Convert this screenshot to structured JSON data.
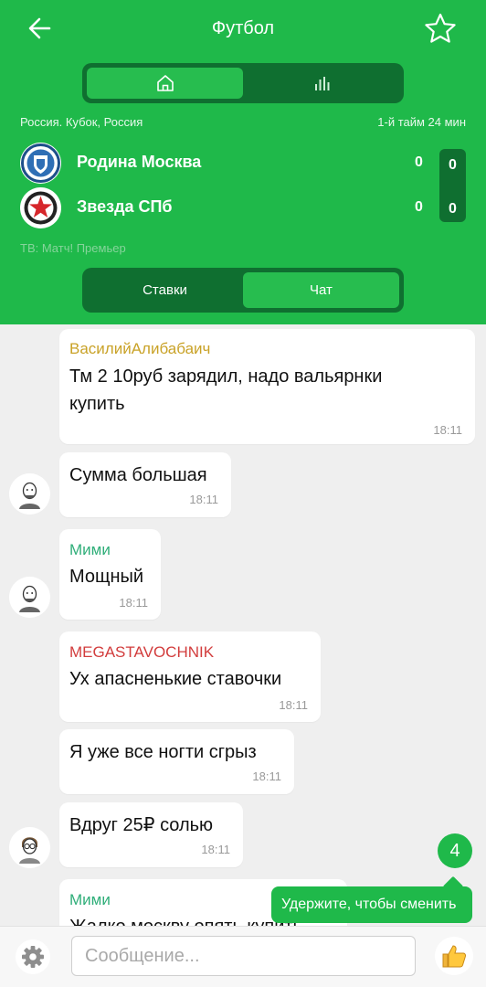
{
  "header": {
    "title": "Футбол",
    "back_icon": "arrow-left-icon",
    "favorite_icon": "star-outline-icon",
    "view_tabs": [
      {
        "icon": "home-icon",
        "active": true
      },
      {
        "icon": "stats-icon",
        "active": false
      }
    ],
    "league": "Россия. Кубок, Россия",
    "match_time": "1-й тайм 24 мин",
    "teams": [
      {
        "name": "Родина Москва",
        "score": "0",
        "period_score": "0"
      },
      {
        "name": "Звезда СПб",
        "score": "0",
        "period_score": "0"
      }
    ],
    "tv": "ТВ: Матч! Премьер",
    "tabs": [
      {
        "label": "Ставки",
        "active": false
      },
      {
        "label": "Чат",
        "active": true
      }
    ]
  },
  "chat": {
    "messages": [
      {
        "author": "ВасилийАлибабаич",
        "author_color": "#c9a227",
        "lines": [
          "Тм 2 10руб зарядил, надо вальярнки",
          "купить"
        ],
        "time": "18:11"
      },
      {
        "author": "",
        "author_color": "",
        "lines": [
          "Сумма большая"
        ],
        "time": "18:11"
      },
      {
        "author": "Мими",
        "author_color": "#2fae79",
        "lines": [
          "Мощный"
        ],
        "time": "18:11"
      },
      {
        "author": "MEGASTAVOCHNIK",
        "author_color": "#d23c3c",
        "lines": [
          "Ух апасненькие ставочки"
        ],
        "time": "18:11"
      },
      {
        "author": "",
        "author_color": "",
        "lines": [
          "Я уже все ногти сгрыз"
        ],
        "time": "18:11"
      },
      {
        "author": "",
        "author_color": "",
        "lines": [
          "Вдруг 25₽ солью"
        ],
        "time": "18:11"
      },
      {
        "author": "Мими",
        "author_color": "#2fae79",
        "lines": [
          "Жалко москву опять купить"
        ],
        "time": ""
      }
    ]
  },
  "unread_badge": "4",
  "tooltip": "Удержите, чтобы сменить",
  "composer": {
    "settings_icon": "gear-icon",
    "placeholder": "Сообщение...",
    "reaction_icon": "thumbs-up-icon"
  },
  "colors": {
    "brand_green": "#1fb94a",
    "dark_green": "#0f6f30"
  }
}
